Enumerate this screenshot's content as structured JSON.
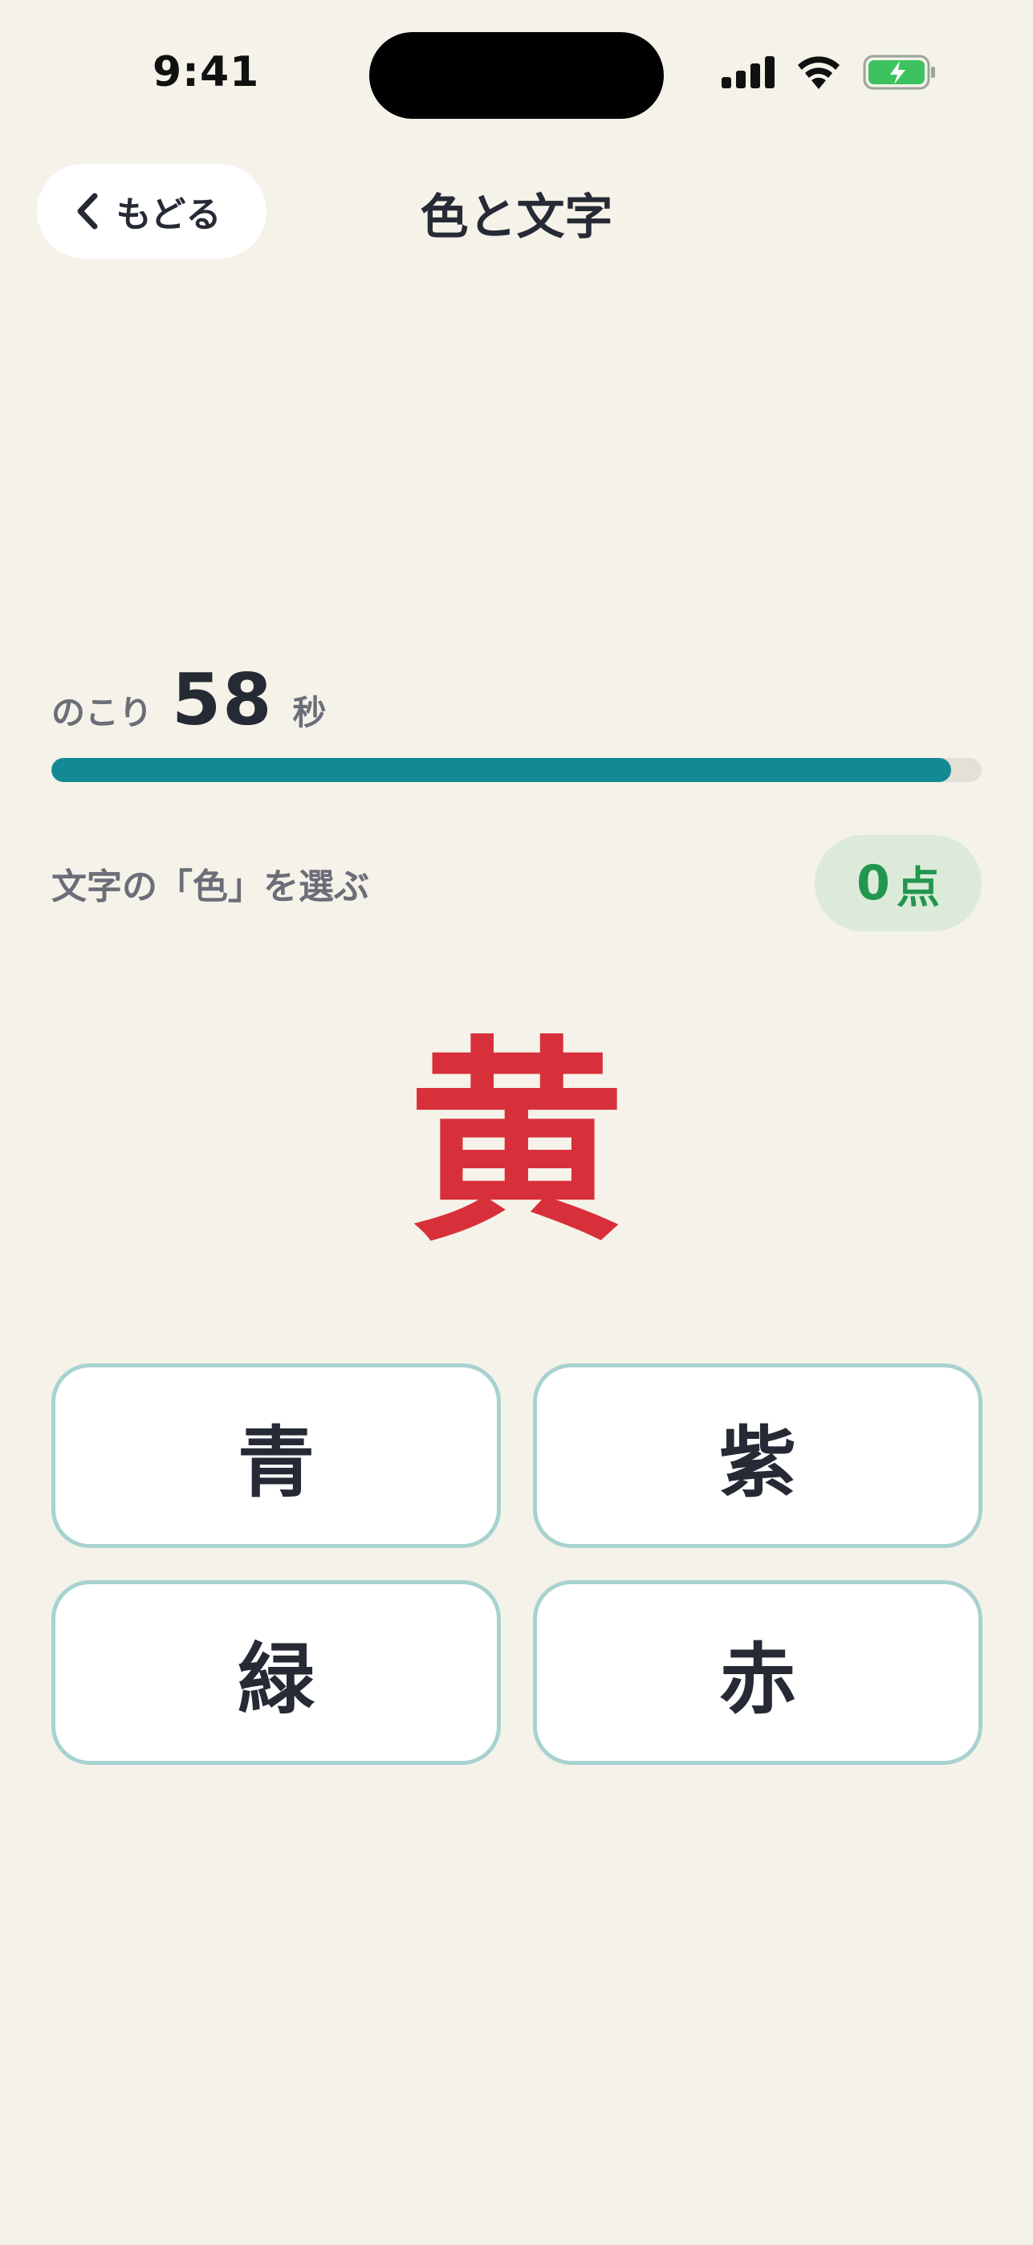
{
  "status_bar": {
    "time": "9:41",
    "icons": [
      "signal-bars-icon",
      "wifi-icon",
      "battery-charging-icon"
    ]
  },
  "nav": {
    "back_label": "もどる",
    "title": "色と文字"
  },
  "timer": {
    "prefix": "のこり",
    "seconds": "58",
    "suffix": "秒",
    "progress_fraction": 0.967
  },
  "instruction": "文字の「色」を選ぶ",
  "score": {
    "value": "0",
    "unit": "点"
  },
  "stimulus": {
    "word": "黄",
    "ink_color": "#d8303a"
  },
  "answers": [
    {
      "label": "青"
    },
    {
      "label": "紫"
    },
    {
      "label": "緑"
    },
    {
      "label": "赤"
    }
  ],
  "colors": {
    "background": "#f5f2e9",
    "accent": "#138a93",
    "score_green": "#22964f",
    "button_border": "#a8d2d0"
  }
}
